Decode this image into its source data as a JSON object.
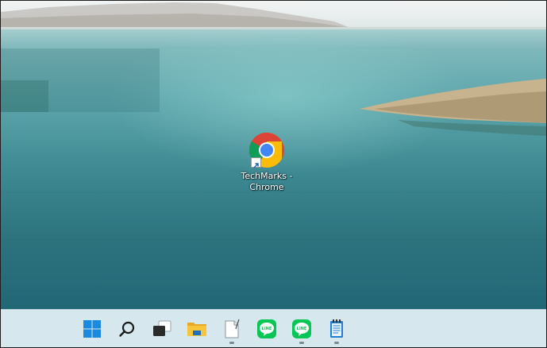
{
  "desktop": {
    "shortcuts": [
      {
        "label_line1": "TechMarks -",
        "label_line2": "Chrome",
        "icon": "chrome-icon",
        "is_shortcut": true
      }
    ]
  },
  "taskbar": {
    "items": [
      {
        "name": "start",
        "icon": "windows-logo-icon",
        "running": false
      },
      {
        "name": "search",
        "icon": "search-icon",
        "running": false
      },
      {
        "name": "task-view",
        "icon": "task-view-icon",
        "running": false
      },
      {
        "name": "file-explorer",
        "icon": "folder-icon",
        "running": false
      },
      {
        "name": "notepad-document",
        "icon": "document-pen-icon",
        "running": true
      },
      {
        "name": "line-app",
        "icon": "line-icon",
        "label": "LINE",
        "running": false
      },
      {
        "name": "line-app-2",
        "icon": "line-icon",
        "label": "LINE",
        "running": true
      },
      {
        "name": "notepad",
        "icon": "notepad-icon",
        "running": true
      }
    ]
  },
  "colors": {
    "taskbar_bg": "#d6e8ee",
    "line_green": "#06c755",
    "windows_blue": "#0078d4",
    "folder_yellow": "#f8c43a"
  }
}
